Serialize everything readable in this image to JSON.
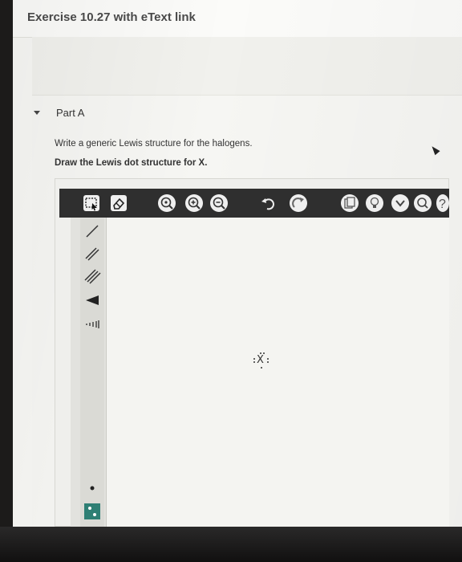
{
  "page": {
    "title": "Exercise 10.27 with eText link"
  },
  "part": {
    "label": "Part A",
    "question": "Write a generic Lewis structure for the halogens.",
    "instruction": "Draw the Lewis dot structure for X."
  },
  "toolbar": {
    "tools": [
      {
        "name": "select-tool",
        "icon": "marquee-select-icon"
      },
      {
        "name": "eraser-tool",
        "icon": "eraser-icon"
      },
      {
        "name": "zoom-fit-tool",
        "icon": "zoom-fit-icon"
      },
      {
        "name": "zoom-in-tool",
        "icon": "zoom-in-icon"
      },
      {
        "name": "zoom-out-tool",
        "icon": "zoom-out-icon"
      },
      {
        "name": "undo-tool",
        "icon": "undo-icon"
      },
      {
        "name": "redo-tool",
        "icon": "redo-icon"
      },
      {
        "name": "copy-tool",
        "icon": "copy-icon"
      },
      {
        "name": "hint-tool",
        "icon": "lightbulb-icon"
      },
      {
        "name": "more-tool",
        "icon": "chevron-down-icon"
      },
      {
        "name": "search-tool",
        "icon": "search-icon"
      },
      {
        "name": "help-tool",
        "icon": "question-icon"
      }
    ]
  },
  "palette": {
    "tools": [
      "single-bond",
      "double-bond",
      "triple-bond",
      "wedge-bond",
      "hashed-bond",
      "lone-electron",
      "electron-pair"
    ]
  },
  "canvas": {
    "atom_symbol": "X"
  },
  "colors": {
    "toolbar": "#2f2f2f",
    "panel": "#f6f6f3"
  }
}
